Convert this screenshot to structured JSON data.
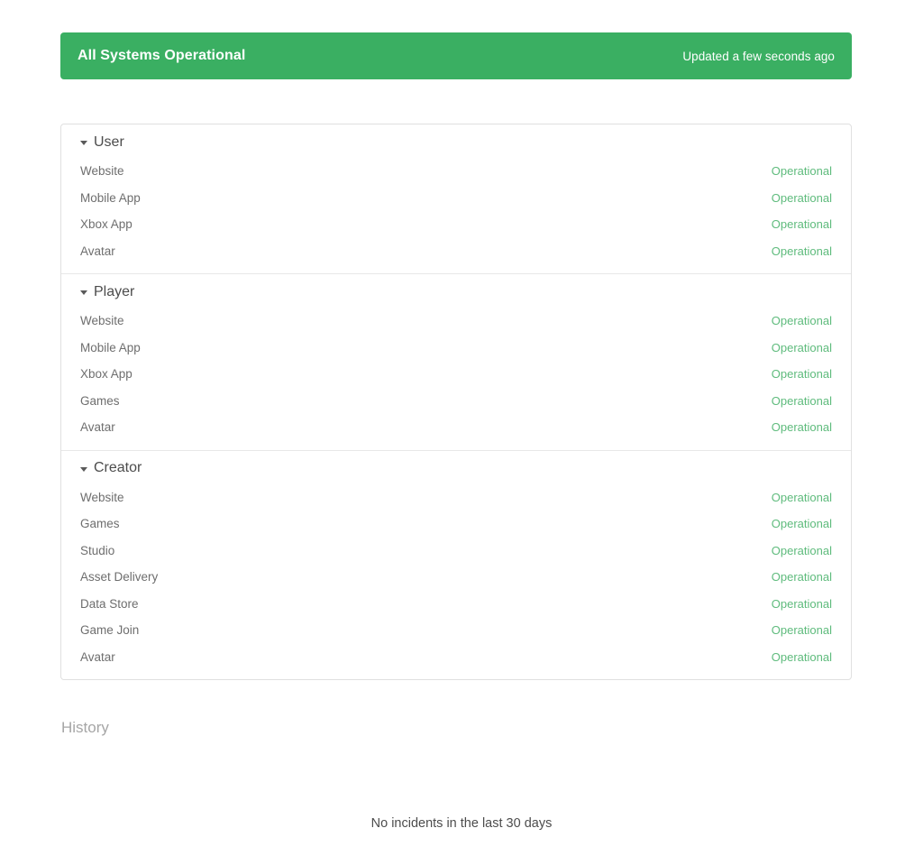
{
  "banner": {
    "title": "All Systems Operational",
    "updated": "Updated a few seconds ago",
    "background_color": "#3aaf62",
    "text_color": "#ffffff"
  },
  "components": {
    "status_color": "#5ebb7c",
    "groups": [
      {
        "name": "User",
        "caret": "caret-down-icon",
        "expanded": true,
        "items": [
          {
            "name": "Website",
            "status": "Operational"
          },
          {
            "name": "Mobile App",
            "status": "Operational"
          },
          {
            "name": "Xbox App",
            "status": "Operational"
          },
          {
            "name": "Avatar",
            "status": "Operational"
          }
        ]
      },
      {
        "name": "Player",
        "caret": "caret-down-icon",
        "expanded": true,
        "items": [
          {
            "name": "Website",
            "status": "Operational"
          },
          {
            "name": "Mobile App",
            "status": "Operational"
          },
          {
            "name": "Xbox App",
            "status": "Operational"
          },
          {
            "name": "Games",
            "status": "Operational"
          },
          {
            "name": "Avatar",
            "status": "Operational"
          }
        ]
      },
      {
        "name": "Creator",
        "caret": "caret-down-icon",
        "expanded": true,
        "items": [
          {
            "name": "Website",
            "status": "Operational"
          },
          {
            "name": "Games",
            "status": "Operational"
          },
          {
            "name": "Studio",
            "status": "Operational"
          },
          {
            "name": "Asset Delivery",
            "status": "Operational"
          },
          {
            "name": "Data Store",
            "status": "Operational"
          },
          {
            "name": "Game Join",
            "status": "Operational"
          },
          {
            "name": "Avatar",
            "status": "Operational"
          }
        ]
      }
    ]
  },
  "history": {
    "heading": "History",
    "empty_message": "No incidents in the last 30 days"
  }
}
